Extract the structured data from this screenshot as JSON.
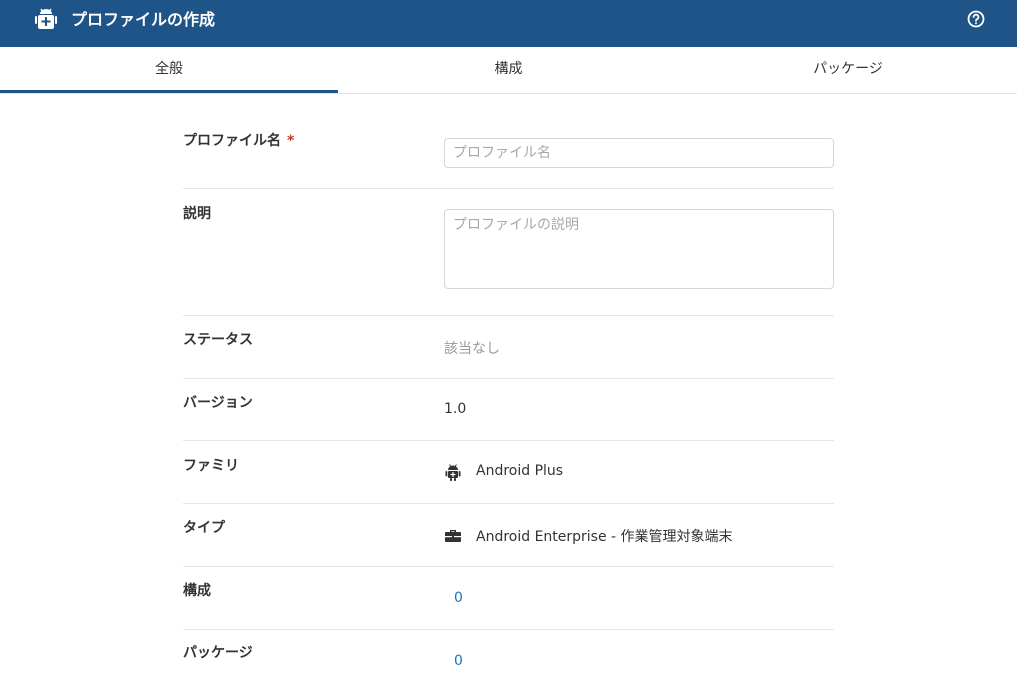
{
  "header": {
    "title": "プロファイルの作成",
    "app_icon": "android-plus-icon",
    "help_icon": "help-circle-icon"
  },
  "tabs": [
    {
      "label": "全般",
      "active": true
    },
    {
      "label": "構成",
      "active": false
    },
    {
      "label": "パッケージ",
      "active": false
    }
  ],
  "form": {
    "profile_name": {
      "label": "プロファイル名",
      "required_mark": "*",
      "value": "",
      "placeholder": "プロファイル名"
    },
    "description": {
      "label": "説明",
      "value": "",
      "placeholder": "プロファイルの説明"
    },
    "status": {
      "label": "ステータス",
      "value": "該当なし"
    },
    "version": {
      "label": "バージョン",
      "value": "1.0"
    },
    "family": {
      "label": "ファミリ",
      "value": "Android Plus",
      "icon": "android-icon"
    },
    "type": {
      "label": "タイプ",
      "value": "Android Enterprise - 作業管理対象端末",
      "icon": "briefcase-icon"
    },
    "configurations": {
      "label": "構成",
      "value": "0"
    },
    "packages": {
      "label": "パッケージ",
      "value": "0"
    }
  },
  "colors": {
    "header_bg": "#1f5488",
    "active_tab_underline": "#1f5488",
    "link": "#1a73b8",
    "required": "#c0392b"
  }
}
